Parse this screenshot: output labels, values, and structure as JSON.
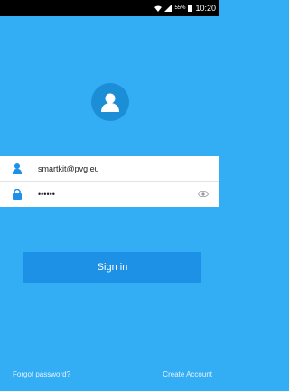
{
  "status_bar": {
    "time": "10:20",
    "battery_pct": "55%",
    "icons": [
      "wifi-icon",
      "signal-icon",
      "battery-icon"
    ]
  },
  "login": {
    "avatar_icon": "user-avatar-icon",
    "email_value": "smartkit@pvg.eu",
    "password_mask": "••••••",
    "email_icon": "person-icon",
    "password_icon": "lock-icon",
    "visibility_icon": "eye-icon",
    "sign_in_label": "Sign in",
    "forgot_password_label": "Forgot password?",
    "create_account_label": "Create Account"
  },
  "colors": {
    "background": "#33adf3",
    "button": "#1d91e6",
    "avatar_circle": "#1c8ed6",
    "field_icon": "#1d91e6"
  }
}
